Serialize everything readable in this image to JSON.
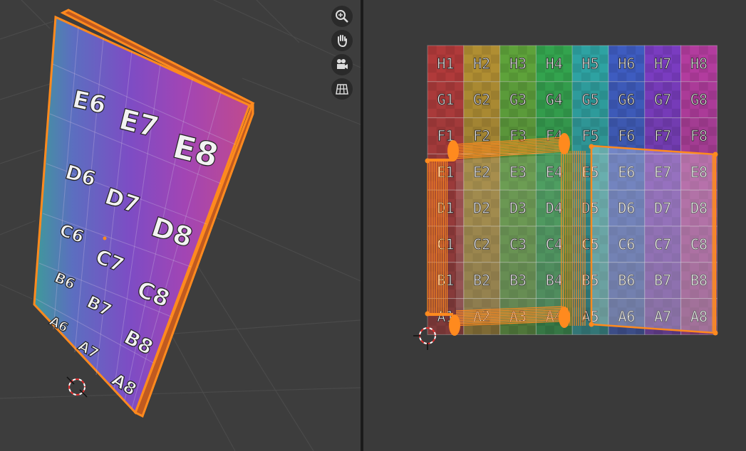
{
  "viewport_3d": {
    "nav_tools": [
      {
        "name": "zoom-icon"
      },
      {
        "name": "hand-icon"
      },
      {
        "name": "camera-icon"
      },
      {
        "name": "grid-icon"
      }
    ],
    "face_labels": [
      "E6",
      "E7",
      "E8",
      "D6",
      "D7",
      "D8",
      "C6",
      "C7",
      "C8",
      "B6",
      "B7",
      "B8",
      "A6",
      "A7",
      "A8"
    ]
  },
  "uv_editor": {
    "grid_rows": [
      [
        "H1",
        "H2",
        "H3",
        "H4",
        "H5",
        "H6",
        "H7",
        "H8"
      ],
      [
        "G1",
        "G2",
        "G3",
        "G4",
        "G5",
        "G6",
        "G7",
        "G8"
      ],
      [
        "F1",
        "F2",
        "F3",
        "F4",
        "F5",
        "F6",
        "F7",
        "F8"
      ],
      [
        "E1",
        "E2",
        "E3",
        "E4",
        "E5",
        "E6",
        "E7",
        "E8"
      ],
      [
        "D1",
        "D2",
        "D3",
        "D4",
        "D5",
        "D6",
        "D7",
        "D8"
      ],
      [
        "C1",
        "C2",
        "C3",
        "C4",
        "C5",
        "C6",
        "C7",
        "C8"
      ],
      [
        "B1",
        "B2",
        "B3",
        "B4",
        "B5",
        "B6",
        "B7",
        "B8"
      ],
      [
        "A1",
        "A2",
        "A3",
        "A4",
        "A5",
        "A6",
        "A7",
        "A8"
      ]
    ],
    "column_colors": [
      "#b03a3a",
      "#b08e32",
      "#5ea23a",
      "#33a34e",
      "#2ea2a2",
      "#3e5cc0",
      "#7a3cc0",
      "#b23c9e"
    ],
    "selection_color": "#ff8a1e"
  }
}
